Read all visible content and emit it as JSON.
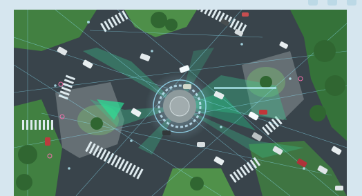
{
  "scene": {
    "description_type": "aerial-intersection",
    "accent_color": "#35c98a",
    "grid_color": "#6fe3ff",
    "road_color": "#30373c",
    "grass_color": "#3f7d35"
  },
  "icons": [
    "decorative-tab-icon",
    "decorative-tab-icon",
    "decorative-tab-icon"
  ]
}
